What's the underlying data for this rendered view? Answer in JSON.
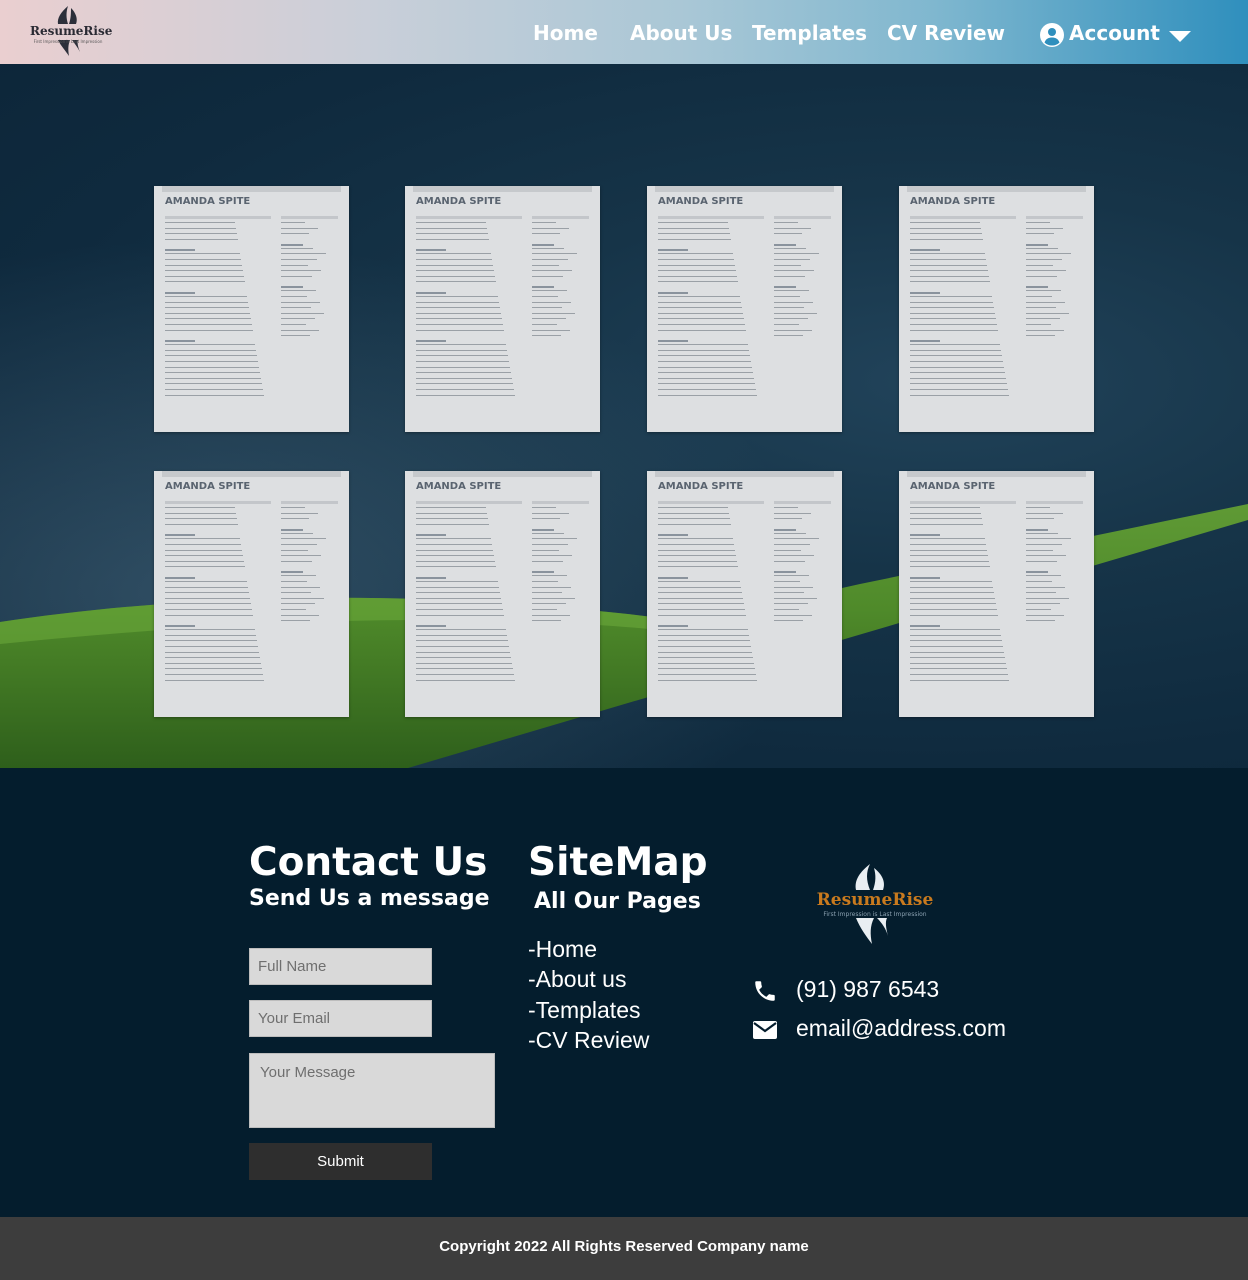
{
  "brand": {
    "name": "ResumeRise",
    "tagline": "First Impression is Last Impression"
  },
  "nav": {
    "items": [
      {
        "label": "Home"
      },
      {
        "label": "About Us"
      },
      {
        "label": "Templates"
      },
      {
        "label": "CV Review"
      }
    ],
    "account_label": "Account"
  },
  "templates": [
    {
      "name": "AMANDA SPITE"
    },
    {
      "name": "AMANDA SPITE"
    },
    {
      "name": "AMANDA SPITE"
    },
    {
      "name": "AMANDA SPITE"
    },
    {
      "name": "AMANDA SPITE"
    },
    {
      "name": "AMANDA SPITE"
    },
    {
      "name": "AMANDA SPITE"
    },
    {
      "name": "AMANDA SPITE"
    }
  ],
  "contact_form": {
    "title": "Contact Us",
    "subtitle": "Send Us a message",
    "full_name_placeholder": "Full Name",
    "email_placeholder": "Your Email",
    "message_placeholder": "Your Message",
    "submit_label": "Submit"
  },
  "sitemap": {
    "title": "SiteMap",
    "subtitle": "All Our Pages",
    "links": [
      "-Home",
      "-About us",
      "-Templates",
      "-CV Review"
    ]
  },
  "contact_info": {
    "phone": "(91) 987 6543",
    "email": "email@address.com"
  },
  "copyright": "Copyright 2022 All Rights Reserved Company name",
  "colors": {
    "footer_bg": "#041d2d",
    "copyright_bg": "#3d3d3d",
    "brand_accent": "#c97a1e",
    "header_gradient_end": "#2f8fbd"
  }
}
